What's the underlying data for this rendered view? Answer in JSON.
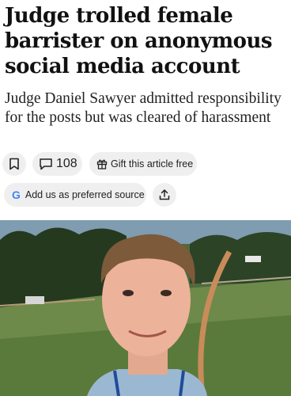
{
  "article": {
    "headline": "Judge trolled female barrister on anonymous social media account",
    "standfirst": "Judge Daniel Sawyer admitted responsibility for the posts but was cleared of harassment"
  },
  "actions": {
    "bookmark_icon": "bookmark-icon",
    "comment_icon": "comment-icon",
    "comment_count": "108",
    "gift_icon": "gift-icon",
    "gift_label": "Gift this article free",
    "google_icon": "google-g-icon",
    "google_letter": "G",
    "preferred_label": "Add us as preferred source",
    "share_icon": "share-icon"
  },
  "colors": {
    "pill_background": "#efefef",
    "text": "#111111",
    "google_blue": "#4285F4"
  }
}
